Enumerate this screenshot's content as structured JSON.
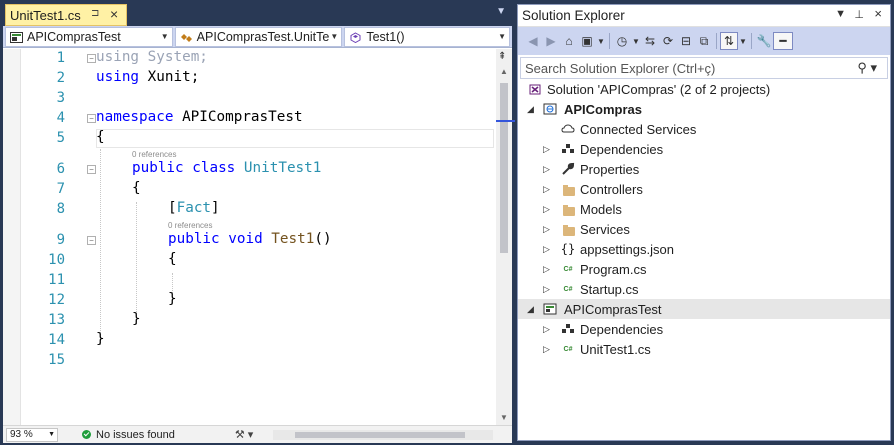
{
  "editor": {
    "tab_title": "UnitTest1.cs",
    "tab_pin": "⊐",
    "tab_close": "×",
    "nav_project": "APIComprasTest",
    "nav_class": "APIComprasTest.UnitTe",
    "nav_member": "Test1()",
    "line_numbers": [
      "1",
      "2",
      "3",
      "4",
      "5",
      "6",
      "7",
      "8",
      "9",
      "10",
      "11",
      "12",
      "13",
      "14",
      "15"
    ],
    "refs_class": "0 references",
    "refs_method": "0 references",
    "code": {
      "l1_kw": "using",
      "l1_rest": " System;",
      "l2_kw": "using",
      "l2_rest": " Xunit;",
      "l4_kw": "namespace",
      "l4_rest": " APIComprasTest",
      "l5": "{",
      "l6_kw": "public class",
      "l6_ty": "UnitTest1",
      "l7": "{",
      "l8_open": "[",
      "l8_ty": "Fact",
      "l8_close": "]",
      "l9_kw": "public void",
      "l9_mt": "Test1",
      "l9_rest": "()",
      "l10": "{",
      "l12": "}",
      "l13": "}",
      "l14": "}"
    },
    "status": {
      "zoom": "93 %",
      "issues": "No issues found"
    }
  },
  "solution_explorer": {
    "title": "Solution Explorer",
    "search_placeholder": "Search Solution Explorer (Ctrl+ç)",
    "tree": [
      {
        "label": "Solution 'APICompras' (2 of 2 projects)"
      },
      {
        "label": "APICompras"
      },
      {
        "label": "Connected Services"
      },
      {
        "label": "Dependencies"
      },
      {
        "label": "Properties"
      },
      {
        "label": "Controllers"
      },
      {
        "label": "Models"
      },
      {
        "label": "Services"
      },
      {
        "label": "appsettings.json"
      },
      {
        "label": "Program.cs"
      },
      {
        "label": "Startup.cs"
      },
      {
        "label": "APIComprasTest"
      },
      {
        "label": "Dependencies"
      },
      {
        "label": "UnitTest1.cs"
      }
    ]
  },
  "colors": {
    "frame": "#293955",
    "active_tab": "#fff1a5",
    "toolbar": "#ccd5f0",
    "keyword": "#0000ff",
    "type": "#2b91af",
    "method": "#74531f",
    "line_number": "#2b91af"
  }
}
